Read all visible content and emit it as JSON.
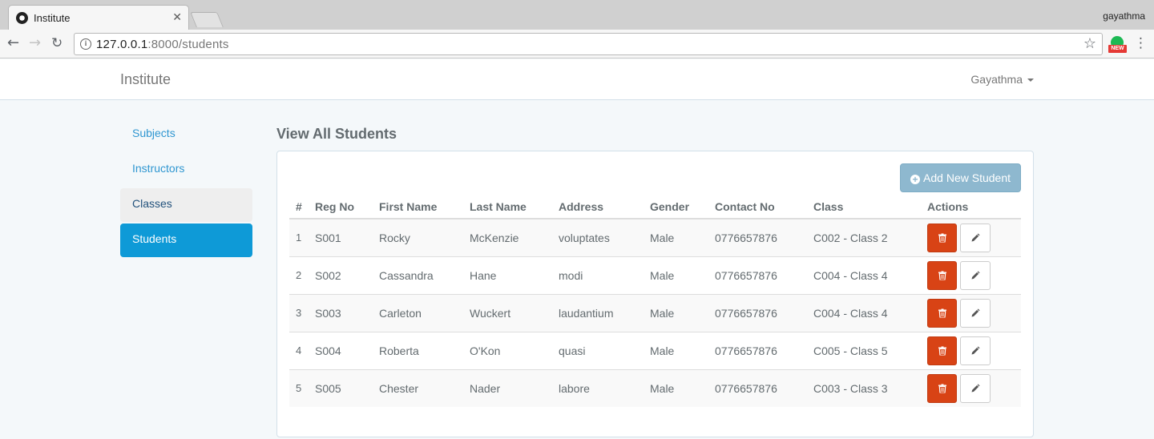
{
  "browser": {
    "tab_title": "Institute",
    "profile": "gayathma",
    "url_host": "127.0.0.1",
    "url_path": ":8000/students",
    "extension_badge": "NEW"
  },
  "navbar": {
    "brand": "Institute",
    "user": "Gayathma"
  },
  "sidebar": {
    "items": [
      {
        "label": "Subjects"
      },
      {
        "label": "Instructors"
      },
      {
        "label": "Classes"
      },
      {
        "label": "Students"
      }
    ]
  },
  "main": {
    "title": "View All Students",
    "add_button": "Add New Student",
    "columns": [
      "#",
      "Reg No",
      "First Name",
      "Last Name",
      "Address",
      "Gender",
      "Contact No",
      "Class",
      "Actions"
    ],
    "rows": [
      {
        "n": "1",
        "reg": "S001",
        "first": "Rocky",
        "last": "McKenzie",
        "address": "voluptates",
        "gender": "Male",
        "contact": "0776657876",
        "class": "C002 - Class 2"
      },
      {
        "n": "2",
        "reg": "S002",
        "first": "Cassandra",
        "last": "Hane",
        "address": "modi",
        "gender": "Male",
        "contact": "0776657876",
        "class": "C004 - Class 4"
      },
      {
        "n": "3",
        "reg": "S003",
        "first": "Carleton",
        "last": "Wuckert",
        "address": "laudantium",
        "gender": "Male",
        "contact": "0776657876",
        "class": "C004 - Class 4"
      },
      {
        "n": "4",
        "reg": "S004",
        "first": "Roberta",
        "last": "O'Kon",
        "address": "quasi",
        "gender": "Male",
        "contact": "0776657876",
        "class": "C005 - Class 5"
      },
      {
        "n": "5",
        "reg": "S005",
        "first": "Chester",
        "last": "Nader",
        "address": "labore",
        "gender": "Male",
        "contact": "0776657876",
        "class": "C003 - Class 3"
      }
    ]
  },
  "colors": {
    "accent": "#0e9ad7",
    "delete": "#d84315",
    "add_button": "#8eb8cf",
    "link": "#3097d1"
  }
}
